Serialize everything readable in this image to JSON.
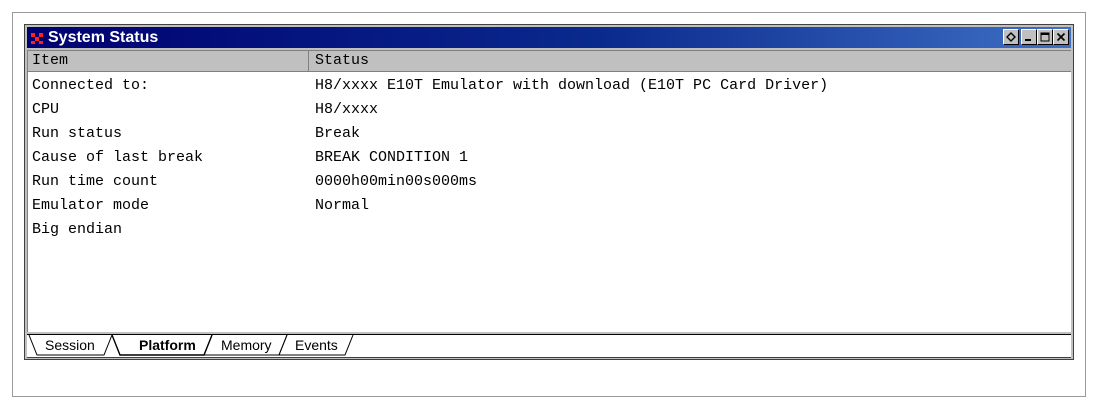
{
  "window": {
    "title": "System Status",
    "icon": "app-icon-red-grid",
    "title_gradient": [
      "#000070",
      "#3f6fc4"
    ]
  },
  "caption_buttons": [
    "restore-icon",
    "minimize-icon",
    "maximize-icon",
    "close-icon"
  ],
  "table": {
    "columns": [
      "Item",
      "Status"
    ],
    "rows": [
      {
        "item": "Connected to:",
        "status": "H8/xxxx E10T Emulator with download (E10T PC Card Driver)"
      },
      {
        "item": "CPU",
        "status": "H8/xxxx"
      },
      {
        "item": "Run status",
        "status": "Break"
      },
      {
        "item": "Cause of last break",
        "status": "BREAK CONDITION 1"
      },
      {
        "item": "Run time count",
        "status": "0000h00min00s000ms"
      },
      {
        "item": "Emulator mode",
        "status": "Normal"
      },
      {
        "item": "Big endian",
        "status": ""
      }
    ]
  },
  "tabs": [
    {
      "label": "Session",
      "active": false
    },
    {
      "label": "Platform",
      "active": true
    },
    {
      "label": "Memory",
      "active": false
    },
    {
      "label": "Events",
      "active": false
    }
  ]
}
